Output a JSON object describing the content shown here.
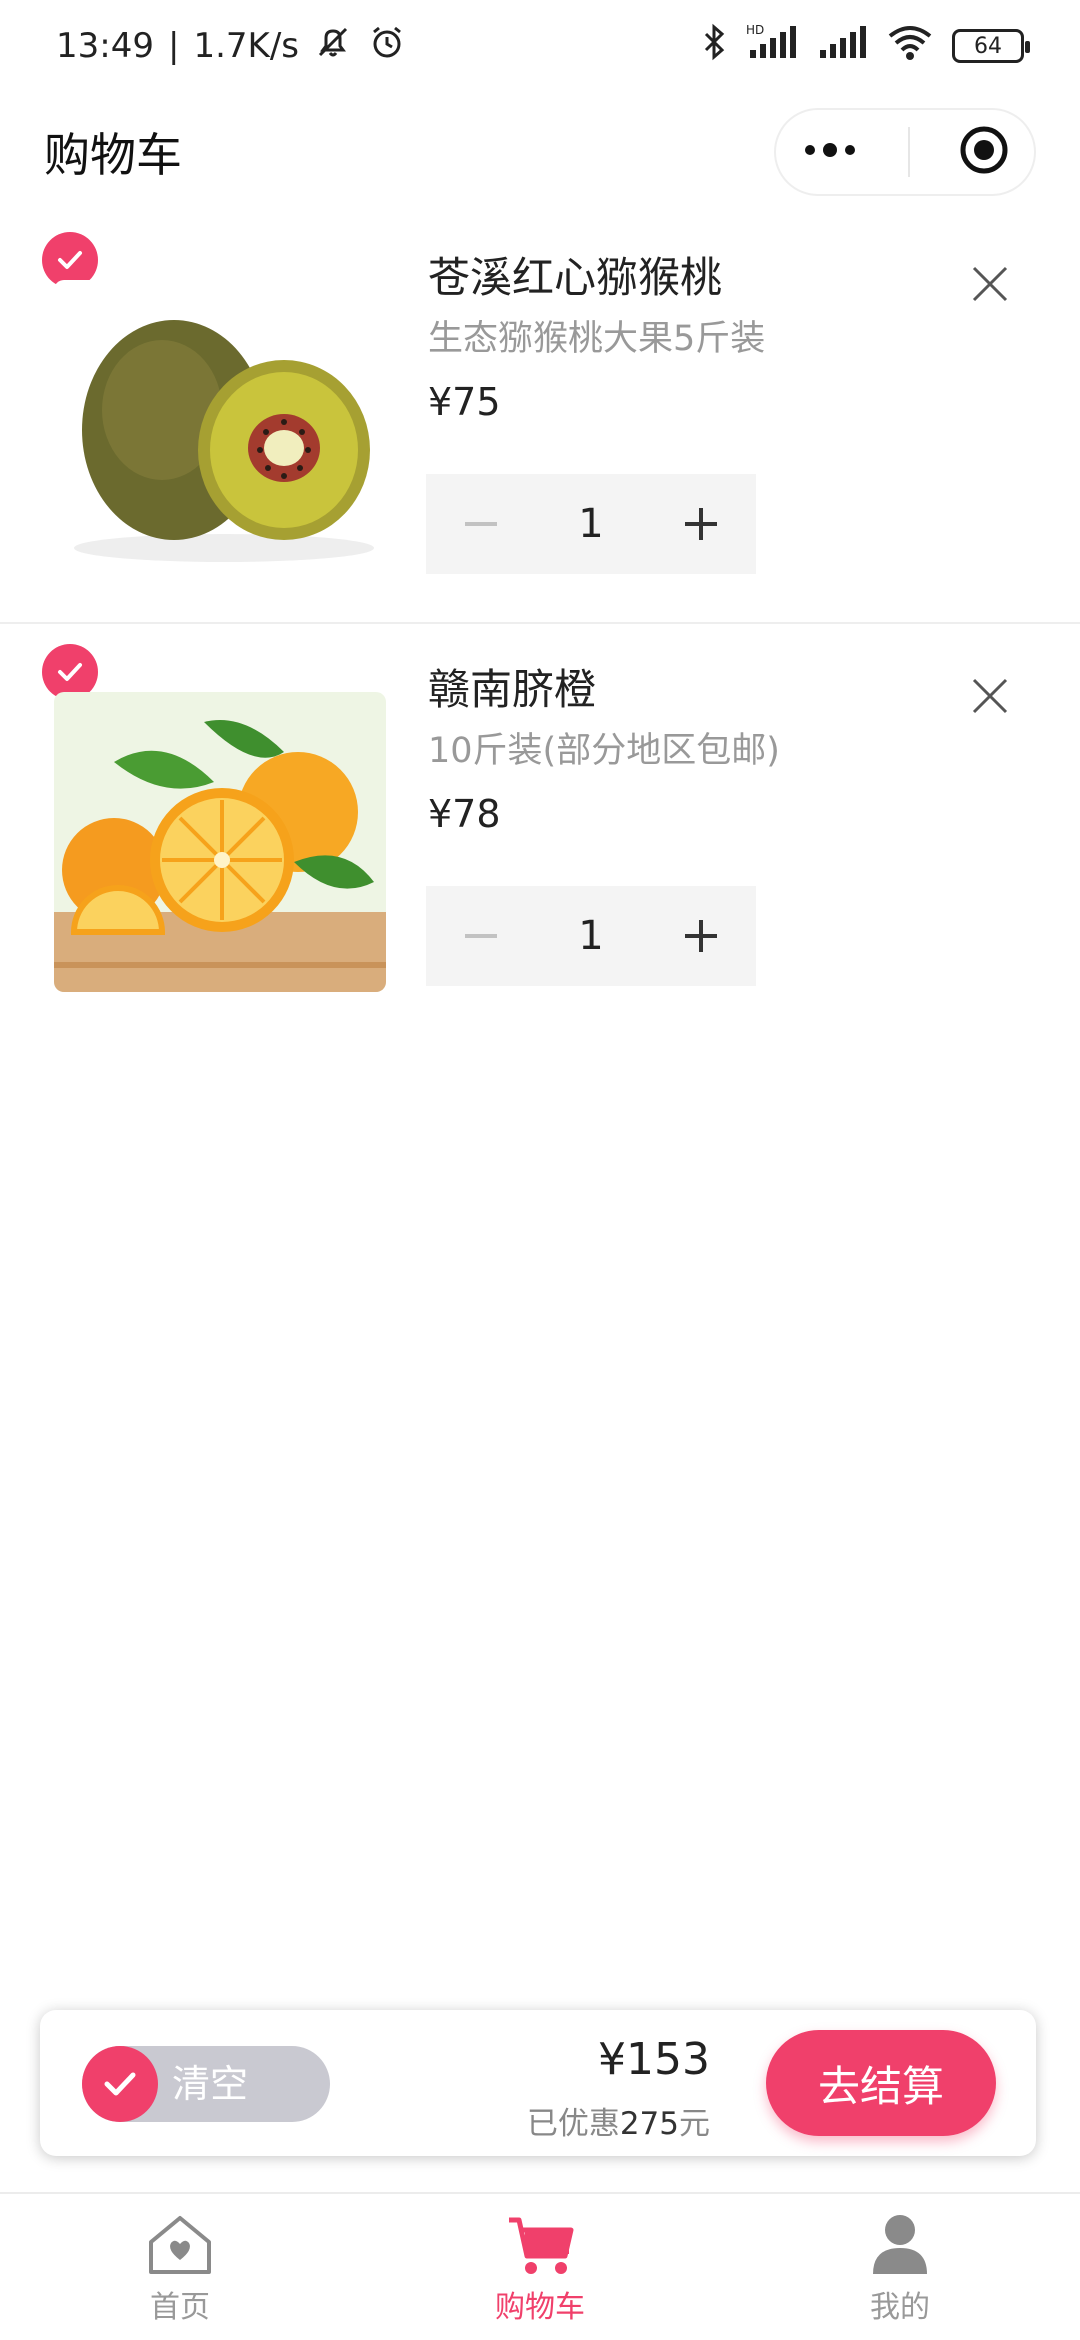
{
  "status_bar": {
    "time": "13:49",
    "speed": "1.7K/s",
    "battery": "64"
  },
  "header": {
    "title": "购物车"
  },
  "cart": {
    "items": [
      {
        "name": "苍溪红心猕猴桃",
        "desc": "生态猕猴桃大果5斤装",
        "price": "¥75",
        "quantity": "1",
        "selected": true,
        "image_icon": "kiwi-fruit-image"
      },
      {
        "name": "赣南脐橙",
        "desc": "10斤装(部分地区包邮)",
        "price": "¥78",
        "quantity": "1",
        "selected": true,
        "image_icon": "navel-orange-image"
      }
    ]
  },
  "checkout": {
    "clear_label": "清空",
    "total": "¥153",
    "discount_prefix": "已优惠",
    "discount_amount": "275",
    "discount_suffix": "元",
    "checkout_label": "去结算"
  },
  "tabbar": {
    "items": [
      {
        "label": "首页",
        "icon": "home-icon",
        "active": false
      },
      {
        "label": "购物车",
        "icon": "cart-icon",
        "active": true
      },
      {
        "label": "我的",
        "icon": "user-icon",
        "active": false
      }
    ]
  },
  "colors": {
    "accent": "#f0406b",
    "muted_toggle": "#c9c9d1",
    "stepper_bg": "#f4f4f4"
  }
}
